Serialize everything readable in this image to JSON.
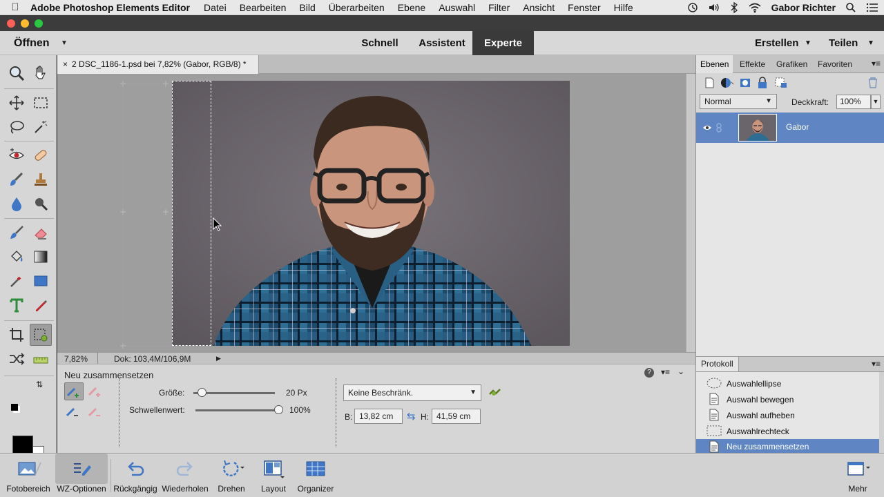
{
  "menubar": {
    "app_name": "Adobe Photoshop Elements Editor",
    "items": [
      "Datei",
      "Bearbeiten",
      "Bild",
      "Überarbeiten",
      "Ebene",
      "Auswahl",
      "Filter",
      "Ansicht",
      "Fenster",
      "Hilfe"
    ],
    "user": "Gabor Richter"
  },
  "modebar": {
    "open_label": "Öffnen",
    "tabs": [
      "Schnell",
      "Assistent",
      "Experte"
    ],
    "active_tab": "Experte",
    "create_label": "Erstellen",
    "share_label": "Teilen"
  },
  "document": {
    "tab_title": "2 DSC_1186-1.psd bei 7,82% (Gabor, RGB/8) *",
    "close_glyph": "×",
    "zoom": "7,82%",
    "doc_size": "Dok: 103,4M/106,9M"
  },
  "tool_options": {
    "title": "Neu zusammensetzen",
    "size_label": "Größe:",
    "size_value": "20 Px",
    "size_fraction": 0.1,
    "threshold_label": "Schwellenwert:",
    "threshold_value": "100%",
    "threshold_fraction": 1.0,
    "preset_select": "Keine Beschränk.",
    "width_label": "B:",
    "width_value": "13,82 cm",
    "height_label": "H:",
    "height_value": "41,59 cm"
  },
  "layers_panel": {
    "tabs": [
      "Ebenen",
      "Effekte",
      "Grafiken",
      "Favoriten"
    ],
    "active_tab": "Ebenen",
    "blend_mode": "Normal",
    "opacity_label": "Deckkraft:",
    "opacity_value": "100%",
    "layer_name": "Gabor"
  },
  "history_panel": {
    "title": "Protokoll",
    "items": [
      "Auswahlellipse",
      "Auswahl bewegen",
      "Auswahl aufheben",
      "Auswahlrechteck",
      "Neu zusammensetzen"
    ],
    "active_index": 4
  },
  "bottombar": {
    "buttons": [
      "Fotobereich",
      "WZ-Optionen",
      "Rückgängig",
      "Wiederholen",
      "Drehen",
      "Layout",
      "Organizer"
    ],
    "more_label": "Mehr"
  },
  "colors": {
    "accent_selection": "#5f86c2",
    "active_mode_tab": "#3a3a3a"
  }
}
